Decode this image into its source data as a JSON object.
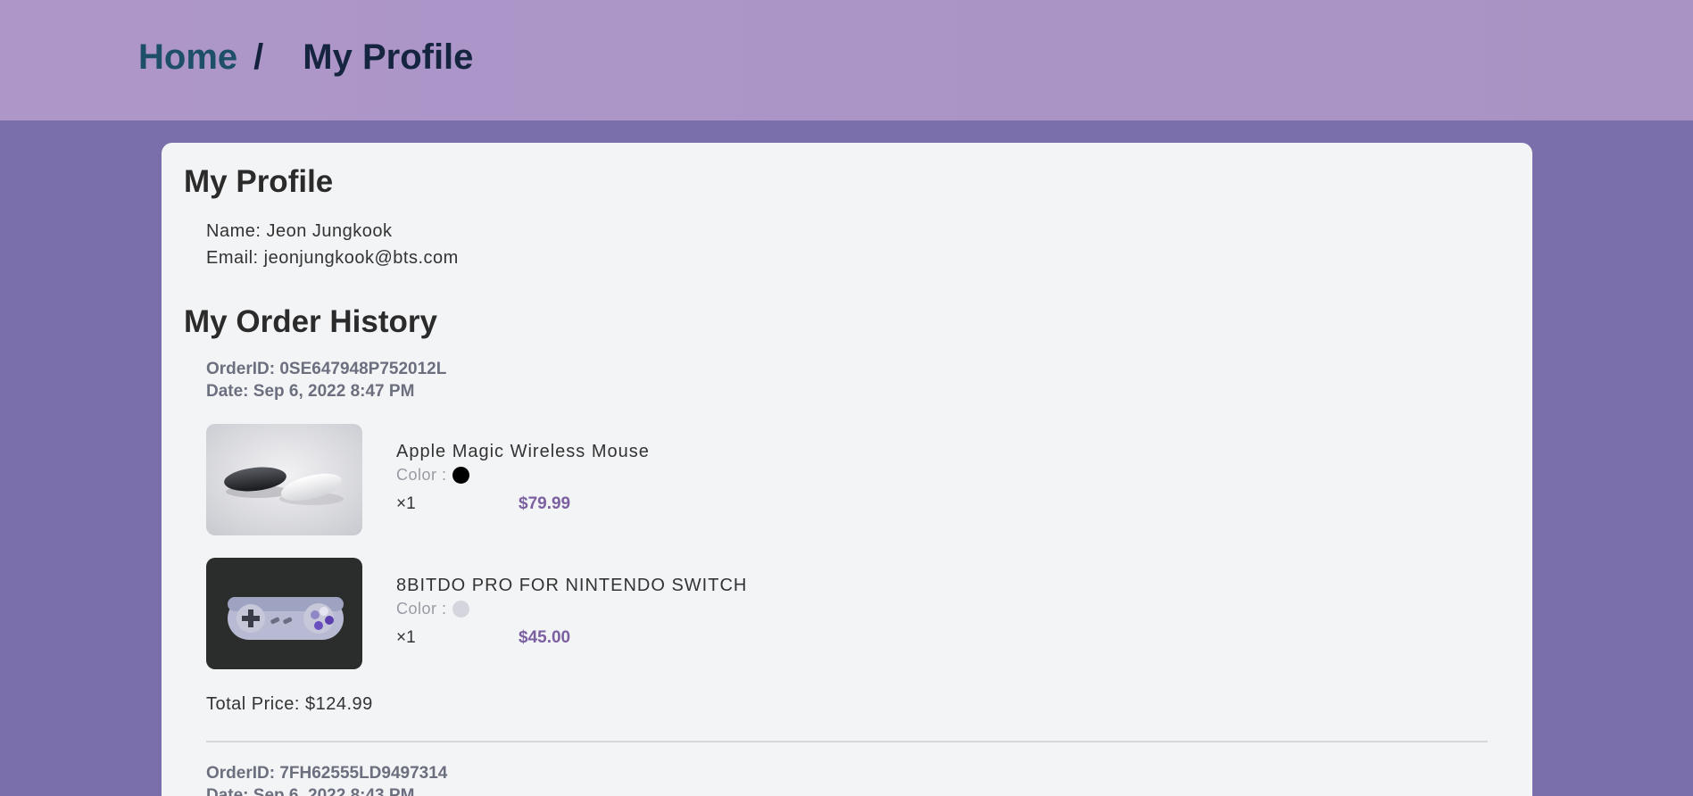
{
  "breadcrumb": {
    "home": "Home",
    "separator": "/",
    "current": "My Profile"
  },
  "profile": {
    "title": "My Profile",
    "name_line": "Name: Jeon Jungkook",
    "email_line": "Email: jeonjungkook@bts.com"
  },
  "orders": {
    "title": "My Order History",
    "list": [
      {
        "order_id": "OrderID: 0SE647948P752012L",
        "date": "Date: Sep 6, 2022 8:47 PM",
        "items": [
          {
            "name": "Apple Magic Wireless Mouse",
            "color_label": "Color :",
            "color": "#000000",
            "qty": "×1",
            "price": "$79.99"
          },
          {
            "name": "8BITDO PRO FOR NINTENDO SWITCH",
            "color_label": "Color :",
            "color": "#d4d5dd",
            "qty": "×1",
            "price": "$45.00"
          }
        ],
        "total": "Total Price: $124.99"
      },
      {
        "order_id": "OrderID: 7FH62555LD9497314",
        "date": "Date: Sep 6, 2022 8:43 PM"
      }
    ]
  },
  "colors": {
    "background": "#7b6fab",
    "header": "#ab95c7",
    "card": "#f3f4f6",
    "price": "#7b5fa0"
  }
}
